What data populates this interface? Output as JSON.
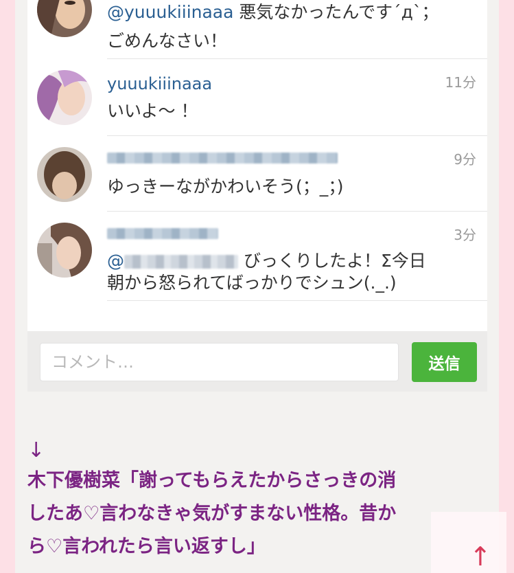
{
  "comments": [
    {
      "username": "",
      "time": "",
      "mention": "@yuuukiiinaaa",
      "line1_text": " 悪気なかったんです´д`；",
      "line2": "ごめんなさい！"
    },
    {
      "username": "yuuukiiinaaa",
      "time": "11分",
      "line1": "いいよ〜 ！"
    },
    {
      "username": "",
      "time": "9分",
      "line1": "ゆっきーながかわいそう(；_；)"
    },
    {
      "username": "",
      "time": "3分",
      "mention": "@",
      "line1_text": " びっくりしたよ！Σ今日",
      "line2": "朝から怒られてばっかりでシュン(._.)"
    }
  ],
  "composer": {
    "placeholder": "コメント…",
    "send_label": "送信"
  },
  "article": {
    "arrow": "↓",
    "line1": "木下優樹菜「謝ってもらえたからさっきの消",
    "line2": "したあ♡言わなきゃ気がすまない性格。昔か",
    "line3": "ら♡言われたら言い返すし」"
  },
  "scroll_top": {
    "arrow": "↑"
  },
  "colors": {
    "username": "#2a5f92",
    "send": "#4bb43c",
    "article": "#7b2483",
    "page_bg": "#fde0e6"
  }
}
